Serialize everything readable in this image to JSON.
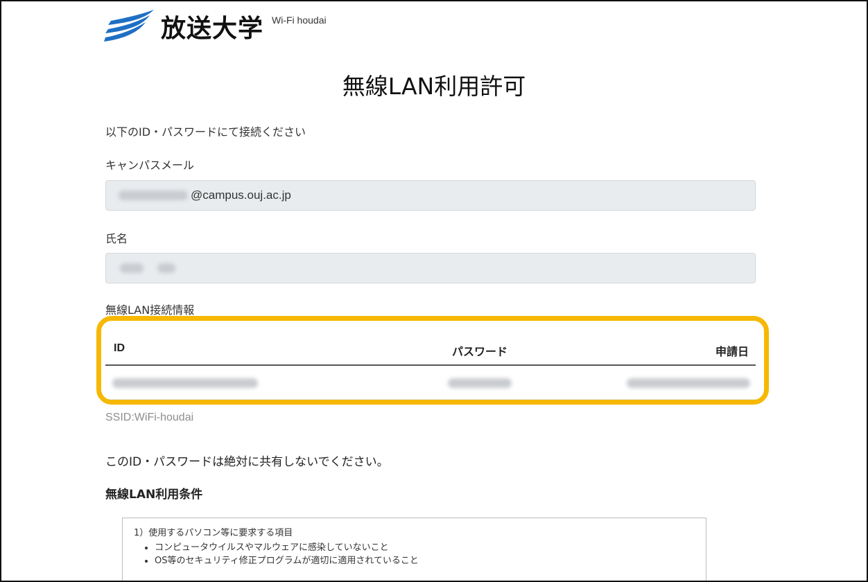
{
  "logo": {
    "name": "放送大学",
    "subtitle": "Wi-Fi houdai"
  },
  "page": {
    "title": "無線LAN利用許可",
    "intro": "以下のID・パスワードにて接続ください"
  },
  "form": {
    "campus_mail": {
      "label": "キャンパスメール",
      "value_suffix": "@campus.ouj.ac.jp"
    },
    "name": {
      "label": "氏名"
    }
  },
  "wlan": {
    "label": "無線LAN接続情報",
    "columns": [
      "ID",
      "パスワード",
      "申請日"
    ],
    "ssid": "SSID:WiFi-houdai"
  },
  "notice": {
    "warning": "このID・パスワードは絶対に共有しないでください。",
    "conditions_heading": "無線LAN利用条件"
  },
  "terms": {
    "item1": "1）使用するパソコン等に要求する項目",
    "bullets": [
      "コンピュータウイルスやマルウェアに感染していないこと",
      "OS等のセキュリティ修正プログラムが適切に適用されていること"
    ]
  },
  "colors": {
    "highlight": "#f6b800",
    "logo_blue": "#1f6fc4"
  }
}
